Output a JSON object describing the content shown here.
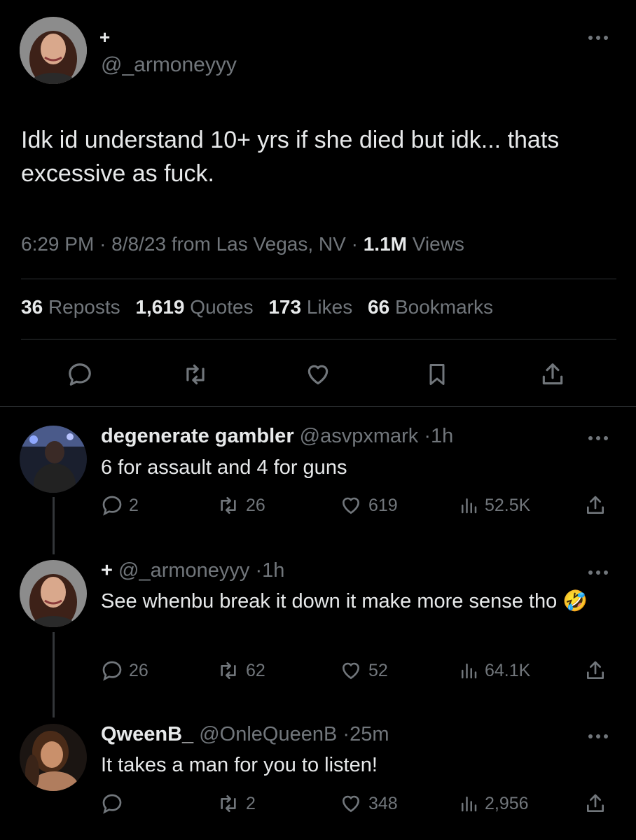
{
  "main_tweet": {
    "author_prefix": "+",
    "handle": "@_armoneyyy",
    "text": "Idk id understand 10+ yrs if she died but idk... thats excessive as fuck.",
    "time": "6:29 PM",
    "date": "8/8/23",
    "location": "from Las Vegas, NV",
    "views_count": "1.1M",
    "views_label": "Views",
    "sep": "·",
    "stats": [
      {
        "count": "36",
        "label": "Reposts"
      },
      {
        "count": "1,619",
        "label": "Quotes"
      },
      {
        "count": "173",
        "label": "Likes"
      },
      {
        "count": "66",
        "label": "Bookmarks"
      }
    ]
  },
  "replies": [
    {
      "name": "degenerate gambler",
      "handle": "@asvpxmark",
      "time": "1h",
      "text": "6 for assault and 4 for guns",
      "replies": "2",
      "reposts": "26",
      "likes": "619",
      "views": "52.5K"
    },
    {
      "name": "+",
      "handle": "@_armoneyyy",
      "time": "1h",
      "text": "See whenbu break it down it make more sense tho 🤣",
      "replies": "26",
      "reposts": "62",
      "likes": "52",
      "views": "64.1K"
    },
    {
      "name": "QweenB_",
      "handle": "@OnleQueenB",
      "time": "25m",
      "text": "It takes a man for you to listen!",
      "replies": "",
      "reposts": "2",
      "likes": "348",
      "views": "2,956"
    }
  ],
  "icons": {
    "reply": "reply-icon",
    "repost": "repost-icon",
    "like": "heart-icon",
    "bookmark": "bookmark-icon",
    "share": "share-icon",
    "views": "views-icon",
    "more": "more-icon"
  },
  "colors": {
    "background": "#000000",
    "text": "#e7e9ea",
    "secondary": "#71767b",
    "divider": "#2f3336"
  }
}
